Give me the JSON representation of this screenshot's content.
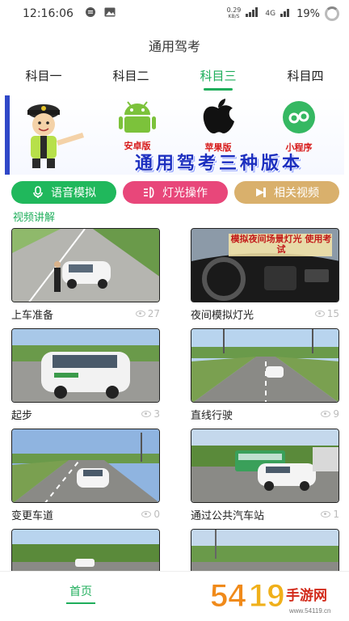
{
  "status": {
    "time": "12:16:06",
    "net_speed_value": "0.29",
    "net_speed_unit": "KB/S",
    "network": "4G",
    "battery": "19%"
  },
  "app": {
    "title": "通用驾考"
  },
  "tabs": [
    {
      "label": "科目一",
      "active": false
    },
    {
      "label": "科目二",
      "active": false
    },
    {
      "label": "科目三",
      "active": true
    },
    {
      "label": "科目四",
      "active": false
    }
  ],
  "banner": {
    "android_caption": "安卓版",
    "apple_caption": "苹果版",
    "miniapp_caption": "小程序",
    "title": "通用驾考三种版本"
  },
  "modes": [
    {
      "label": "语音模拟",
      "color": "#20b85c",
      "icon": "microphone-icon"
    },
    {
      "label": "灯光操作",
      "color": "#e8477a",
      "icon": "headlight-icon"
    },
    {
      "label": "相关视频",
      "color": "#d9b06c",
      "icon": "video-icon"
    }
  ],
  "section": {
    "title": "视频讲解"
  },
  "videos": [
    {
      "title": "上车准备",
      "views": "27",
      "thumb_overlay": ""
    },
    {
      "title": "夜间模拟灯光",
      "views": "15",
      "thumb_overlay": "模拟夜间场景灯光 使用考试"
    },
    {
      "title": "起步",
      "views": "3",
      "thumb_overlay": ""
    },
    {
      "title": "直线行驶",
      "views": "9",
      "thumb_overlay": ""
    },
    {
      "title": "变更车道",
      "views": "0",
      "thumb_overlay": ""
    },
    {
      "title": "通过公共汽车站",
      "views": "1",
      "thumb_overlay": ""
    }
  ],
  "nav": {
    "home": "首页"
  },
  "watermark": {
    "text": "54119手游网",
    "url": "www.54119.cn"
  },
  "colors": {
    "accent": "#1fae5b",
    "banner_blue": "#1c2fc0"
  }
}
